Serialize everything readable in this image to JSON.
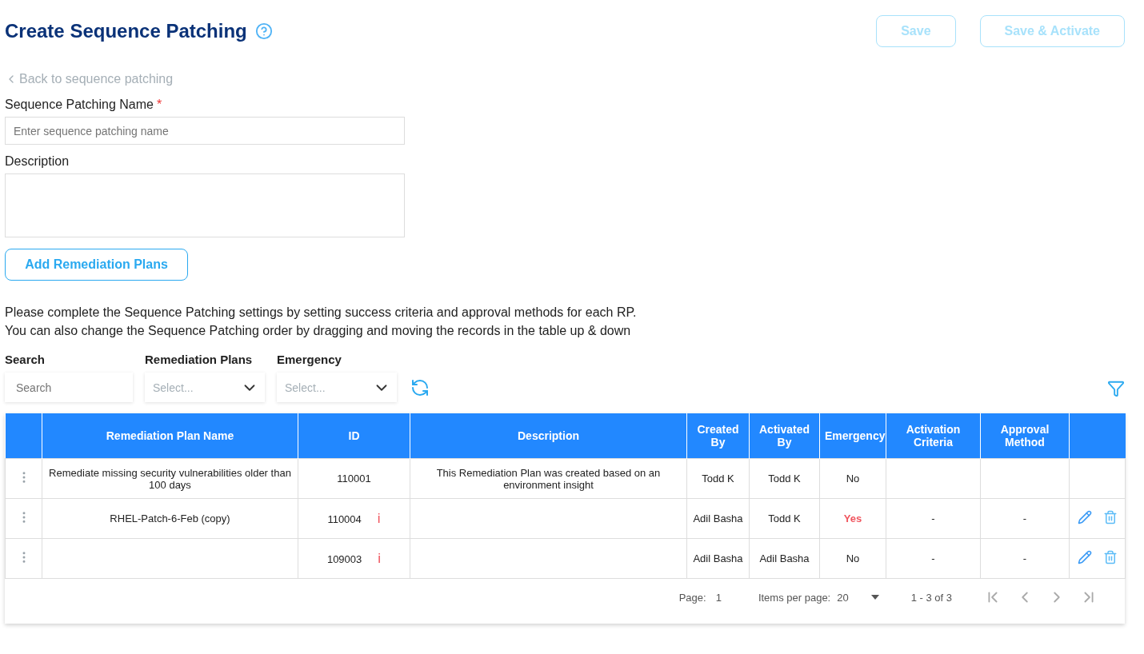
{
  "header": {
    "title": "Create Sequence Patching",
    "buttons": [
      {
        "label": "Save",
        "disabled": true
      },
      {
        "label": "Save & Activate",
        "disabled": true
      }
    ]
  },
  "back_link": "Back to sequence patching",
  "form": {
    "name_label": "Sequence Patching Name",
    "required_mark": "*",
    "name_placeholder": "Enter sequence patching name",
    "description_label": "Description",
    "add_button": "Add Remediation Plans"
  },
  "instructions": [
    "Please complete the Sequence Patching settings by setting success criteria and approval methods for each RP.",
    "You can also change the Sequence Patching order by dragging and moving the records in the table up & down"
  ],
  "filters": {
    "search_label": "Search",
    "search_placeholder": "Search",
    "selects": [
      {
        "label": "Remediation Plans",
        "placeholder": "Select..."
      },
      {
        "label": "Emergency",
        "placeholder": "Select..."
      }
    ]
  },
  "table": {
    "columns": [
      "Remediation Plan Name",
      "ID",
      "Description",
      "Created By",
      "Activated By",
      "Emergency",
      "Activation Criteria",
      "Approval Method"
    ],
    "rows": [
      {
        "name": "Remediate missing security vulnerabilities older than 100 days",
        "id": "110001",
        "alert_mark": "",
        "description": "This Remediation Plan was created based on an environment insight",
        "created_by": "Todd K",
        "activated_by": "Todd K",
        "emergency": "No",
        "emergency_alert": false,
        "activation_criteria": "",
        "approval_method": "",
        "actions": false
      },
      {
        "name": "RHEL-Patch-6-Feb (copy)",
        "id": "110004",
        "alert_mark": "i",
        "description": "",
        "created_by": "Adil Basha",
        "activated_by": "Todd K",
        "emergency": "Yes",
        "emergency_alert": true,
        "activation_criteria": "-",
        "approval_method": "-",
        "actions": true
      },
      {
        "name": "",
        "id": "109003",
        "alert_mark": "i",
        "description": "",
        "created_by": "Adil Basha",
        "activated_by": "Adil Basha",
        "emergency": "No",
        "emergency_alert": false,
        "activation_criteria": "-",
        "approval_method": "-",
        "actions": true
      }
    ]
  },
  "pagination": {
    "page_label": "Page:",
    "page": "1",
    "items_label": "Items per page:",
    "items": "20",
    "range": "1 - 3 of 3"
  }
}
